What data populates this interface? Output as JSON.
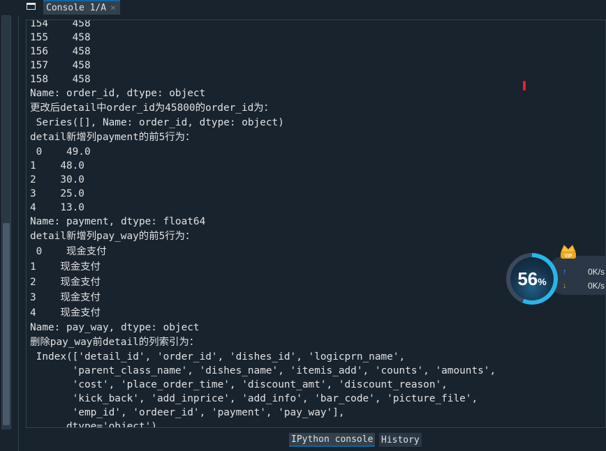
{
  "tabbar": {
    "console_tab_label": "Console 1/A",
    "close_glyph": "✕",
    "undock_icon": "window-icon"
  },
  "console": {
    "lines": [
      "154    458",
      "155    458",
      "156    458",
      "157    458",
      "158    458",
      "Name: order_id, dtype: object",
      "更改后detail中order_id为45800的order_id为：",
      " Series([], Name: order_id, dtype: object)",
      "detail新增列payment的前5行为：",
      " 0    49.0",
      "1    48.0",
      "2    30.0",
      "3    25.0",
      "4    13.0",
      "Name: payment, dtype: float64",
      "detail新增列pay_way的前5行为：",
      " 0    现金支付",
      "1    现金支付",
      "2    现金支付",
      "3    现金支付",
      "4    现金支付",
      "Name: pay_way, dtype: object",
      "删除pay_way前detail的列索引为：",
      " Index(['detail_id', 'order_id', 'dishes_id', 'logicprn_name',",
      "       'parent_class_name', 'dishes_name', 'itemis_add', 'counts', 'amounts',",
      "       'cost', 'place_order_time', 'discount_amt', 'discount_reason',",
      "       'kick_back', 'add_inprice', 'add_info', 'bar_code', 'picture_file',",
      "       'emp_id', 'ordeer_id', 'payment', 'pay_way'],",
      "      dtype='object')"
    ]
  },
  "bottom_tabs": {
    "ipython_label": "IPython console",
    "history_label": "History"
  },
  "widget": {
    "percent": "56",
    "percent_sign": "%",
    "vip_label": "VIP",
    "upload": "0K/s",
    "download": "0K/s"
  },
  "colors": {
    "background": "#19232d",
    "tab_active": "#32414b",
    "accent": "#1464a0",
    "text": "#e0e1e3",
    "gauge": "#29b5e8"
  }
}
